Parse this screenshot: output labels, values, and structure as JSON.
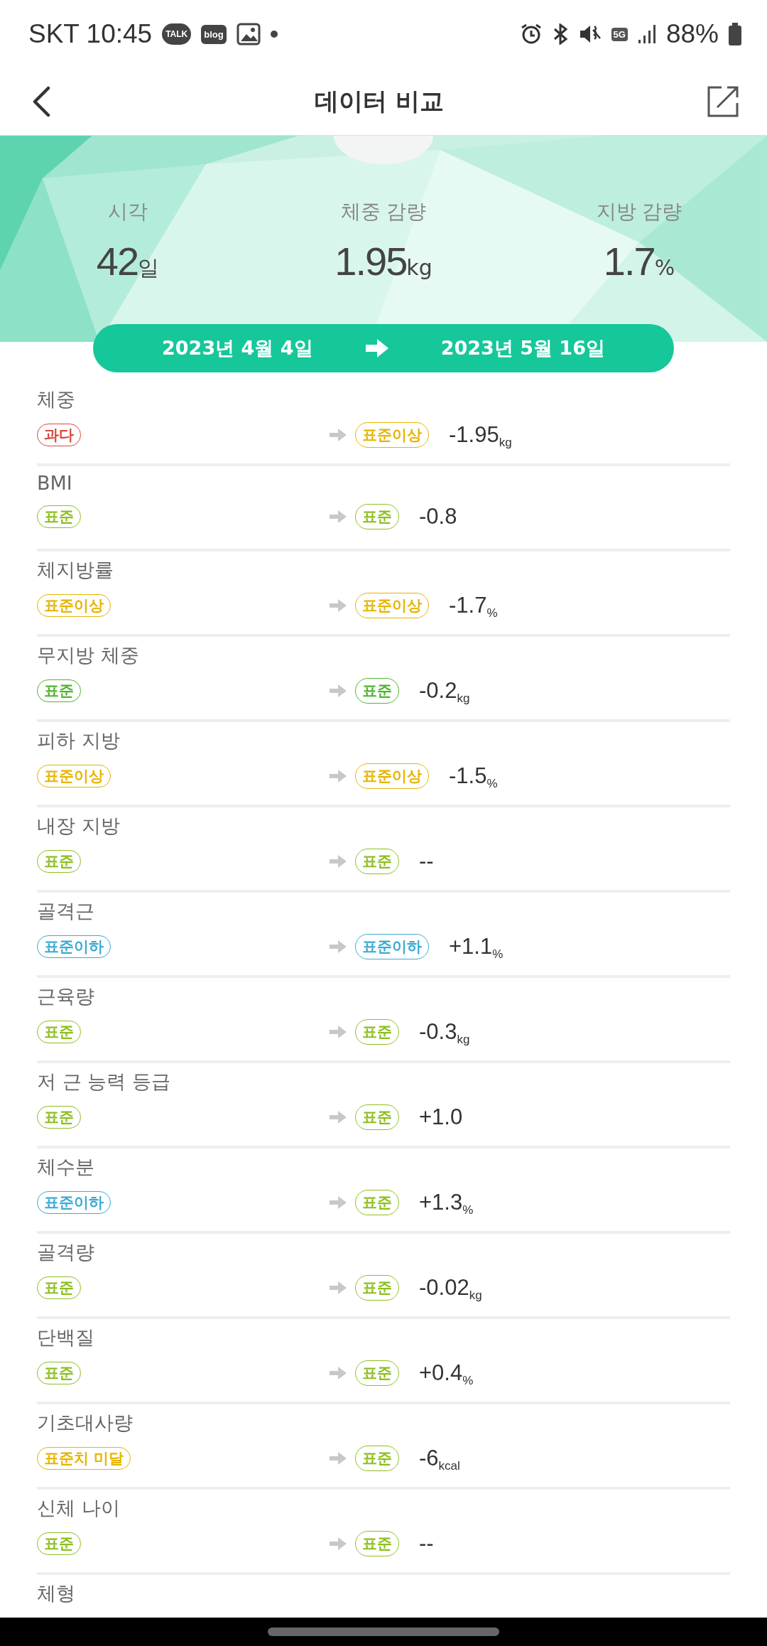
{
  "status_bar": {
    "carrier_time": "SKT 10:45",
    "talk_icon_text": "TALK",
    "blog_icon_text": "blog",
    "network_text": "5G",
    "battery": "88%"
  },
  "header": {
    "title": "데이터 비교"
  },
  "summary": [
    {
      "label": "시각",
      "value": "42",
      "unit": "일"
    },
    {
      "label": "체중 감량",
      "value": "1.95",
      "unit": "kg"
    },
    {
      "label": "지방 감량",
      "value": "1.7",
      "unit": "%"
    }
  ],
  "date_range": {
    "from": "2023년 4월 4일",
    "to": "2023년 5월 16일"
  },
  "rows": [
    {
      "label": "체중",
      "from": {
        "text": "과다",
        "color": "#d94a3d"
      },
      "to": {
        "text": "표준이상",
        "color": "#e6b400"
      },
      "change": "-1.95$_{kg}$"
    },
    {
      "label": "BMI",
      "from": {
        "text": "표준",
        "color": "#8dbf1f"
      },
      "to": {
        "text": "표준",
        "color": "#8dbf1f"
      },
      "change": "-0.8"
    },
    {
      "label": "체지방률",
      "from": {
        "text": "표준이상",
        "color": "#e6b400"
      },
      "to": {
        "text": "표준이상",
        "color": "#e6b400"
      },
      "change": "-1.7$_{%}$"
    },
    {
      "label": "무지방 체중",
      "from": {
        "text": "표준",
        "color": "#4fb52e"
      },
      "to": {
        "text": "표준",
        "color": "#4fb52e"
      },
      "change": "-0.2$_{kg}$"
    },
    {
      "label": "피하 지방",
      "from": {
        "text": "표준이상",
        "color": "#e6b400"
      },
      "to": {
        "text": "표준이상",
        "color": "#e6b400"
      },
      "change": "-1.5$_{%}$"
    },
    {
      "label": "내장 지방",
      "from": {
        "text": "표준",
        "color": "#8dbf1f"
      },
      "to": {
        "text": "표준",
        "color": "#8dbf1f"
      },
      "change": "--"
    },
    {
      "label": "골격근",
      "from": {
        "text": "표준이하",
        "color": "#3aaad4"
      },
      "to": {
        "text": "표준이하",
        "color": "#3aaad4"
      },
      "change": "+1.1$_{%}$"
    },
    {
      "label": "근육량",
      "from": {
        "text": "표준",
        "color": "#8dbf1f"
      },
      "to": {
        "text": "표준",
        "color": "#8dbf1f"
      },
      "change": "-0.3$_{kg}$"
    },
    {
      "label": "저 근 능력 등급",
      "from": {
        "text": "표준",
        "color": "#8dbf1f"
      },
      "to": {
        "text": "표준",
        "color": "#8dbf1f"
      },
      "change": "+1.0"
    },
    {
      "label": "체수분",
      "from": {
        "text": "표준이하",
        "color": "#3aaad4"
      },
      "to": {
        "text": "표준",
        "color": "#8dbf1f"
      },
      "change": "+1.3$_{%}$"
    },
    {
      "label": "골격량",
      "from": {
        "text": "표준",
        "color": "#8dbf1f"
      },
      "to": {
        "text": "표준",
        "color": "#8dbf1f"
      },
      "change": "-0.02$_{kg}$"
    },
    {
      "label": "단백질",
      "from": {
        "text": "표준",
        "color": "#8dbf1f"
      },
      "to": {
        "text": "표준",
        "color": "#8dbf1f"
      },
      "change": "+0.4$_{%}$"
    },
    {
      "label": "기초대사량",
      "from": {
        "text": "표준치 미달",
        "color": "#e6b400"
      },
      "to": {
        "text": "표준",
        "color": "#8dbf1f"
      },
      "change": "-6$_{kcal}$"
    },
    {
      "label": "신체 나이",
      "from": {
        "text": "표준",
        "color": "#8dbf1f"
      },
      "to": {
        "text": "표준",
        "color": "#8dbf1f"
      },
      "change": "--"
    }
  ],
  "partial_row": {
    "label": "체형"
  }
}
